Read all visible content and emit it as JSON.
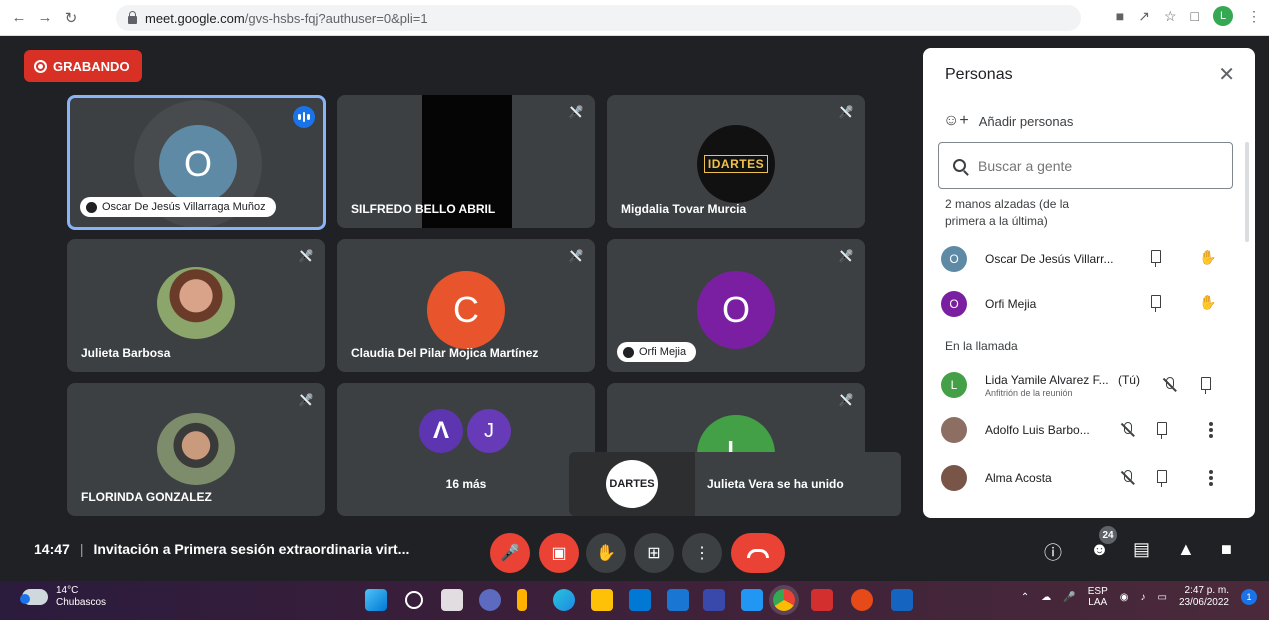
{
  "browser": {
    "url_host": "meet.google.com",
    "url_path": "/gvs-hsbs-fqj?authuser=0&pli=1",
    "profile_initial": "L"
  },
  "recording": {
    "label": "GRABANDO"
  },
  "tiles": [
    {
      "name": "Oscar De Jesús Villarraga Muñoz",
      "initial": "O",
      "color": "#5f8aa6"
    },
    {
      "name": "SILFREDO BELLO ABRIL"
    },
    {
      "name": "Migdalia Tovar Murcia",
      "logo_text": "IDARTES"
    },
    {
      "name": "Julieta Barbosa"
    },
    {
      "name": "Claudia Del Pilar Mojica Martínez",
      "initial": "C",
      "color": "#e8542c"
    },
    {
      "name": "Orfi Mejia",
      "initial": "O",
      "color": "#7b1fa2"
    },
    {
      "name": "FLORINDA GONZALEZ"
    },
    {
      "name": "16 más",
      "initial": "J",
      "color": "#673ab7"
    },
    {
      "initial": "L",
      "color": "#43a047"
    }
  ],
  "toast": {
    "message": "Julieta Vera se ha unido",
    "logo_text": "DARTES"
  },
  "people_panel": {
    "title": "Personas",
    "add_people_label": "Añadir personas",
    "search_placeholder": "Buscar a gente",
    "raised_hands_label_line1": "2 manos alzadas (de la",
    "raised_hands_label_line2": "primera a la última)",
    "raised": [
      {
        "name": "Oscar De Jesús Villarr...",
        "initial": "O",
        "color": "#5f8aa6"
      },
      {
        "name": "Orfi Mejia",
        "initial": "O",
        "color": "#7b1fa2"
      }
    ],
    "in_call_label": "En la llamada",
    "in_call": [
      {
        "name": "Lida Yamile Alvarez F...",
        "suffix": "(Tú)",
        "subtitle": "Anfitrión de la reunión",
        "initial": "L",
        "color": "#43a047"
      },
      {
        "name": "Adolfo Luis Barbo...",
        "initial": "",
        "color": "#8d6e63"
      },
      {
        "name": "Alma Acosta",
        "initial": "",
        "color": "#795548"
      }
    ]
  },
  "meeting": {
    "time": "14:47",
    "title": "Invitación a Primera sesión extraordinaria virt...",
    "participants_count": "24"
  },
  "taskbar": {
    "temperature": "14°C",
    "weather": "Chubascos",
    "lang_line1": "ESP",
    "lang_line2": "LAA",
    "clock_time": "2:47 p. m.",
    "clock_date": "23/06/2022",
    "notifications": "1"
  }
}
